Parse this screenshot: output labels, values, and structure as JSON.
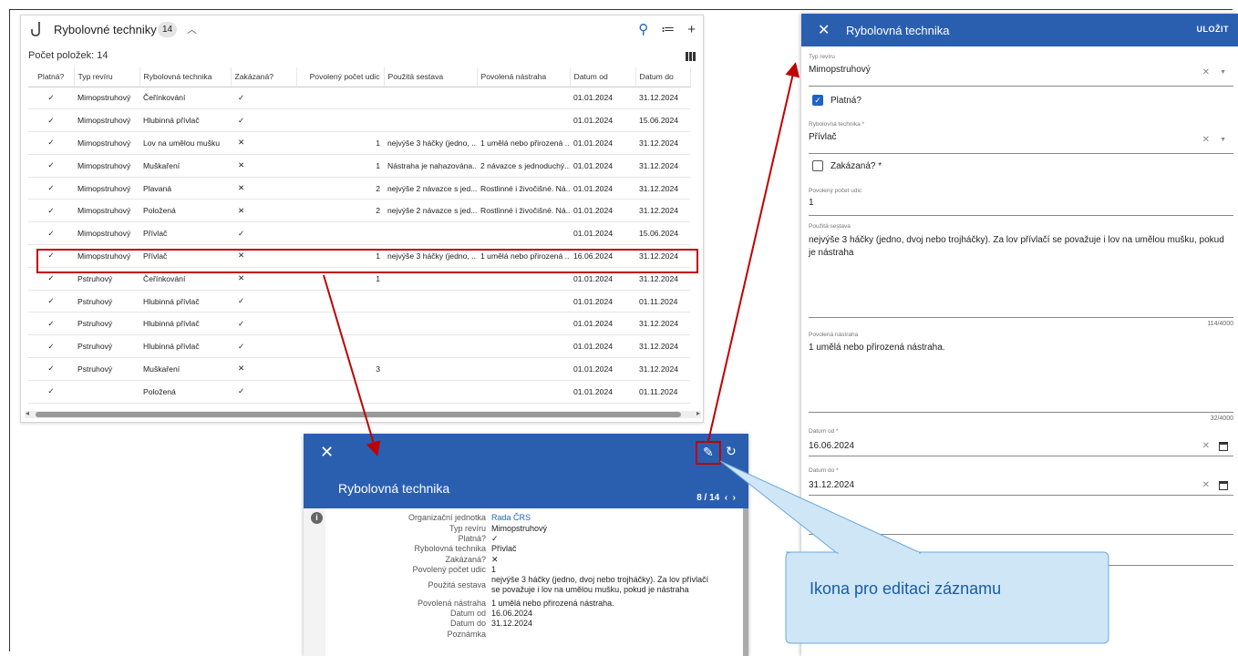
{
  "table_panel": {
    "title": "Rybolovné techniky",
    "count": "14",
    "items_count": "Počet položek: 14",
    "headers": [
      "Platná?",
      "Typ revíru",
      "Rybolovná technika",
      "Zakázaná?",
      "Povolený počet udic",
      "Použitá sestava",
      "Povolená nástraha",
      "Datum od",
      "Datum do"
    ],
    "rows": [
      [
        "✓",
        "Mimopstruhový",
        "Čeřínkování",
        "✓",
        "",
        "",
        "",
        "01.01.2024",
        "31.12.2024"
      ],
      [
        "✓",
        "Mimopstruhový",
        "Hlubinná přívlač",
        "✓",
        "",
        "",
        "",
        "01.01.2024",
        "15.06.2024"
      ],
      [
        "✓",
        "Mimopstruhový",
        "Lov na umělou mušku",
        "✕",
        "1",
        "nejvýše 3 háčky (jedno, ...",
        "1 umělá nebo přirozená ...",
        "01.01.2024",
        "31.12.2024"
      ],
      [
        "✓",
        "Mimopstruhový",
        "Muškaření",
        "✕",
        "1",
        "Nástraha je nahazována...",
        "2 návazce s jednoduchý...",
        "01.01.2024",
        "31.12.2024"
      ],
      [
        "✓",
        "Mimopstruhový",
        "Plavaná",
        "✕",
        "2",
        "nejvýše 2 návazce s jed...",
        "Rostlinné i živočišné. Ná...",
        "01.01.2024",
        "31.12.2024"
      ],
      [
        "✓",
        "Mimopstruhový",
        "Položená",
        "✕",
        "2",
        "nejvýše 2 návazce s jed...",
        "Rostlinné i živočišné. Ná...",
        "01.01.2024",
        "31.12.2024"
      ],
      [
        "✓",
        "Mimopstruhový",
        "Přívlač",
        "✓",
        "",
        "",
        "",
        "01.01.2024",
        "15.06.2024"
      ],
      [
        "✓",
        "Mimopstruhový",
        "Přívlač",
        "✕",
        "1",
        "nejvýše 3 háčky (jedno, ...",
        "1 umělá nebo přirozená ...",
        "16.06.2024",
        "31.12.2024"
      ],
      [
        "✓",
        "Pstruhový",
        "Čeřínkování",
        "✕",
        "1",
        "",
        "",
        "01.01.2024",
        "31.12.2024"
      ],
      [
        "✓",
        "Pstruhový",
        "Hlubinná přívlač",
        "✓",
        "",
        "",
        "",
        "01.01.2024",
        "01.11.2024"
      ],
      [
        "✓",
        "Pstruhový",
        "Hlubinná přívlač",
        "✓",
        "",
        "",
        "",
        "01.01.2024",
        "31.12.2024"
      ],
      [
        "✓",
        "Pstruhový",
        "Hlubinná přívlač",
        "✓",
        "",
        "",
        "",
        "01.01.2024",
        "31.12.2024"
      ],
      [
        "✓",
        "Pstruhový",
        "Muškaření",
        "✕",
        "3",
        "",
        "",
        "01.01.2024",
        "31.12.2024"
      ],
      [
        "✓",
        "",
        "Položená",
        "✓",
        "",
        "",
        "",
        "01.01.2024",
        "01.11.2024"
      ]
    ]
  },
  "detail_panel": {
    "title": "Rybolovná technika",
    "pager": "8 / 14",
    "fields": [
      {
        "label": "Organizační jednotka",
        "value": "Rada ČRS",
        "link": true
      },
      {
        "label": "Typ revíru",
        "value": "Mimopstruhový"
      },
      {
        "label": "Platná?",
        "value": "✓"
      },
      {
        "label": "Rybolovná technika",
        "value": "Přívlač"
      },
      {
        "label": "Zakázaná?",
        "value": "✕"
      },
      {
        "label": "Povolený počet udic",
        "value": "1"
      },
      {
        "label": "Použitá sestava",
        "value": "nejvýše 3 háčky (jedno, dvoj nebo trojháčky). Za lov přívlačí se považuje i lov na umělou mušku, pokud je nástraha"
      },
      {
        "label": "Povolená nástraha",
        "value": "1 umělá nebo přirozená nástraha."
      },
      {
        "label": "Datum od",
        "value": "16.06.2024"
      },
      {
        "label": "Datum do",
        "value": "31.12.2024"
      },
      {
        "label": "Poznámka",
        "value": ""
      }
    ]
  },
  "edit_panel": {
    "title": "Rybolovná technika",
    "save": "ULOŽIT",
    "typ_reviru_label": "Typ revíru",
    "typ_reviru_value": "Mimopstruhový",
    "platna_label": "Platná?",
    "technika_label": "Rybolovná technika *",
    "technika_value": "Přívlač",
    "zakazana_label": "Zakázaná? *",
    "udic_label": "Povolený počet udic",
    "udic_value": "1",
    "sestava_label": "Použitá sestava",
    "sestava_value": "nejvýše 3 háčky (jedno, dvoj nebo trojháčky). Za lov přívlačí se považuje i lov na umělou mušku, pokud je nástraha",
    "sestava_count": "114/4000",
    "nastraha_label": "Povolená nástraha",
    "nastraha_value": "1 umělá nebo přirozená nástraha.",
    "nastraha_count": "32/4000",
    "datum_od_label": "Datum od *",
    "datum_od_value": "16.06.2024",
    "datum_do_label": "Datum do *",
    "datum_do_value": "31.12.2024"
  },
  "callout": {
    "text": "Ikona pro editaci záznamu"
  },
  "colors": {
    "header_blue": "#2a5fb0",
    "highlight_red": "#c00000",
    "callout_fill": "#cfe6f7",
    "callout_text": "#1a5aa8"
  }
}
